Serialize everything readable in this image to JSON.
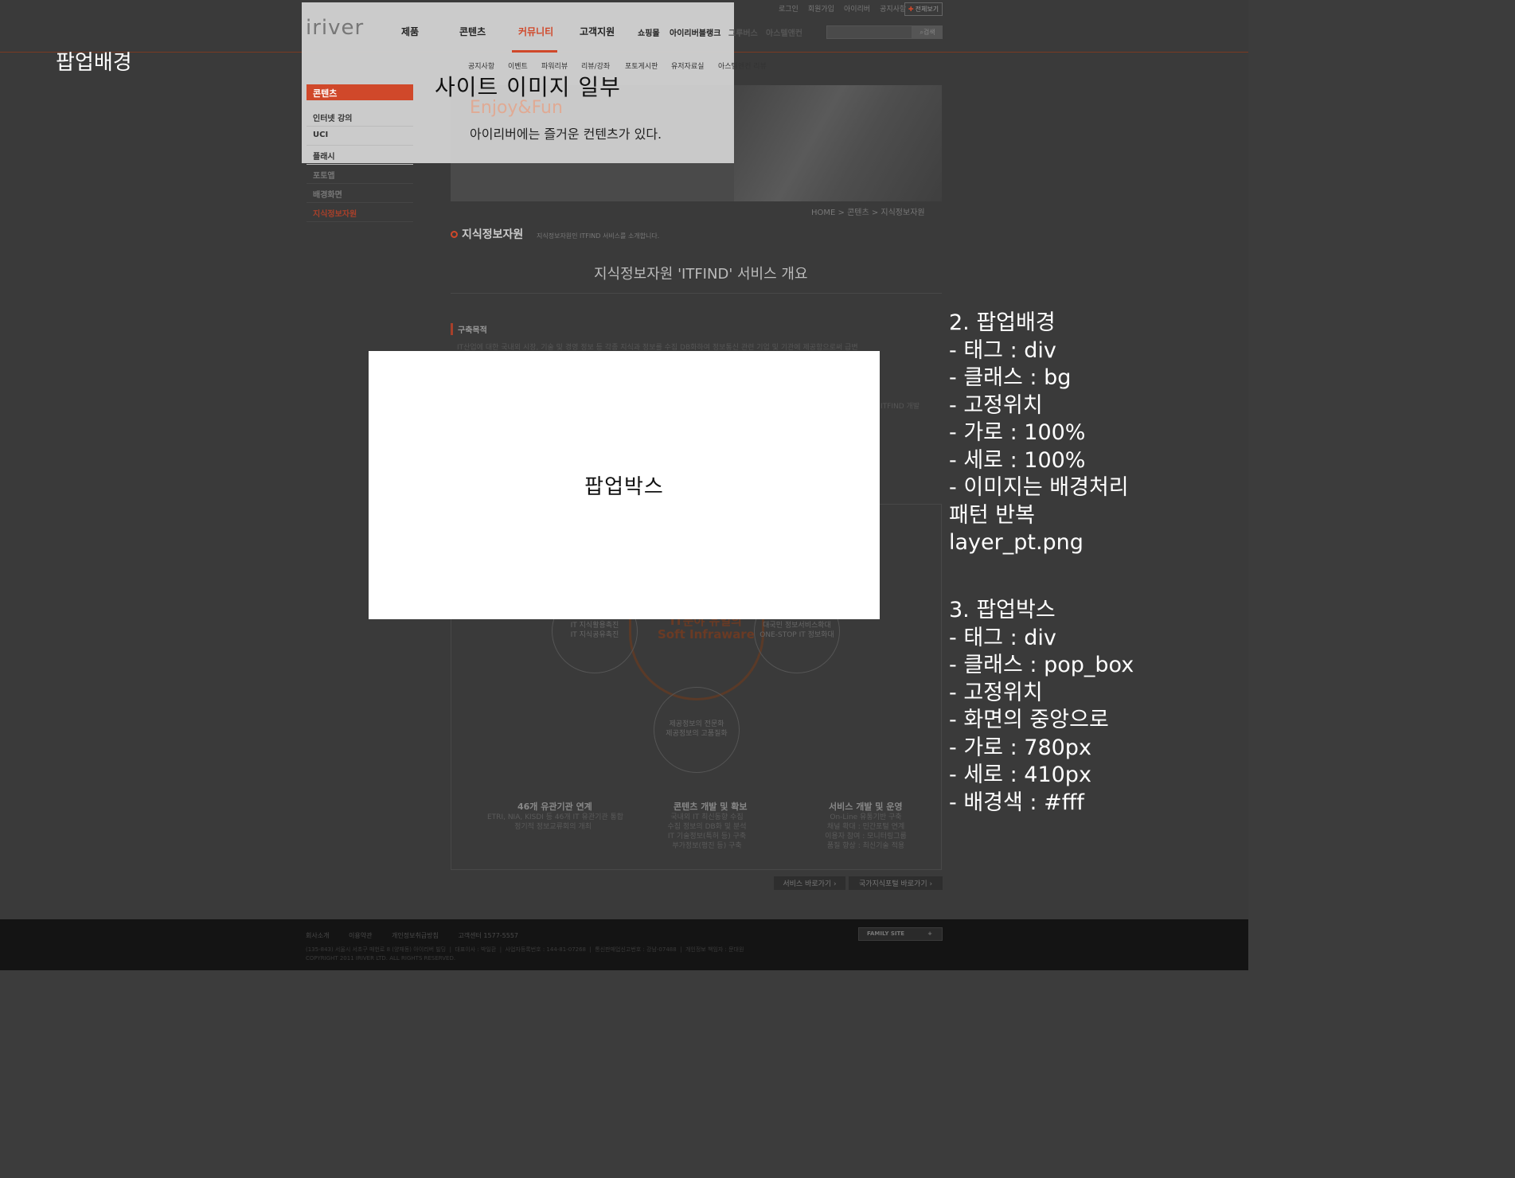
{
  "site": {
    "util_links": [
      "로그인",
      "회원가입",
      "아이리버",
      "공지사항"
    ],
    "all_button": "전체보기",
    "search_button": "검색",
    "logo": "iriver",
    "gnb": [
      "제품",
      "콘텐츠",
      "커뮤니티",
      "고객지원"
    ],
    "gnb_small": [
      "쇼핑몰",
      "아이리버블랭크",
      "그루버스",
      "아스텔앤컨"
    ],
    "lnb": [
      "공지사항",
      "이벤트",
      "파워리뷰",
      "리뷰/강좌",
      "포토게시판",
      "유저자료실",
      "아스텔앤컨 리뷰"
    ],
    "side_title": "콘텐츠",
    "side_items": [
      "인터넷 강의",
      "UCI",
      "플래시",
      "포토앱",
      "배경화면",
      "지식정보자원"
    ],
    "visual_title": "Enjoy&Fun",
    "visual_sub": "아이리버에는 즐거운 컨텐츠가 있다.",
    "breadcrumb": "HOME  >  콘텐츠  >  지식정보자원",
    "content_title": "지식정보자원",
    "content_desc": "지식정보자원인 ITFIND 서비스를 소개합니다.",
    "section_heading": "지식정보자원 'ITFIND' 서비스 개요",
    "sub_head": "구축목적",
    "paragraph_1": "IT산업에 대한 국내외 시장, 기술 및 경영 정보 등 각종 지식과 정보를 수집 DB화하여 정보통신 관련 기업 및 기관에 제공함으로써 급변",
    "paragraph_2": "ITFIND 개발",
    "circle_left": "IT 지식활용촉진\nIT 지식공유촉진",
    "circle_center": "IT분야 유일의\nSoft Infraware",
    "circle_right": "대국민 정보서비스확대\nONE-STOP IT 정보화대",
    "circle_bottom": "제공정보의 전문화\n제공정보의 고품질화",
    "col_titles": [
      "46개 유관기관 연계",
      "콘텐츠 개발 및 확보",
      "서비스 개발 및 운영"
    ],
    "col_texts": [
      "ETRI, NIA, KISDI 등 46개 IT 유관기관 통합\n정기적 정보교류회의 개최",
      "국내외 IT 최신동향 수집\n수집 정보의 DB화 및 분석\nIT 기술정보(특허 등) 구축\n부가정보(평진 등) 구축",
      "On-Line 유통기반 구축\n채널 확대 : 민간포털 연계\n이용자 참여 : 모니터링그룹\n품질 향상 : 최신기술 적용"
    ],
    "btn_service": "서비스 바로가기 ›",
    "btn_portal": "국가지식포털 바로가기 ›",
    "footer_links": [
      "회사소개",
      "이용약관",
      "개인정보취급방침",
      "고객센터 1577-5557"
    ],
    "footer_copy": "(135-843) 서울시 서초구 매헌로 8 (양재동) 아이리버 빌딩  |  대표이사 : 박일환  |  사업자등록번호 : 144-81-07268  |  통신판매업신고번호 : 강남-07488  |  개인정보 책임자 : 문대원\nCOPYRIGHT 2011 IRIVER LTD. ALL RIGHTS RESERVED.",
    "family_site": "FAMILY SITE"
  },
  "annotations": {
    "bg_label": "팝업배경",
    "site_label": "사이트 이미지 일부",
    "popup_label": "팝업박스",
    "note_bg": "2. 팝업배경\n- 태그 : div\n- 클래스 : bg\n- 고정위치\n- 가로 : 100%\n- 세로 : 100%\n- 이미지는 배경처리\n패턴 반복\nlayer_pt.png",
    "note_popup": "3. 팝업박스\n- 태그 : div\n- 클래스 : pop_box\n- 고정위치\n- 화면의 중앙으로\n- 가로 : 780px\n- 세로 : 410px\n- 배경색 : #fff"
  },
  "colors": {
    "accent": "#d0482a",
    "overlay": "#3a3a3a",
    "popup": "#ffffff"
  }
}
